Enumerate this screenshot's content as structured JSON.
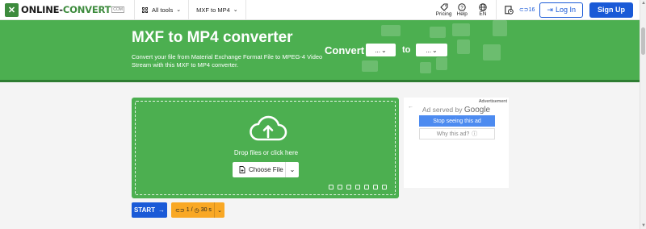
{
  "header": {
    "logo_text_a": "ONLINE-",
    "logo_text_b": "CONVERT",
    "logo_sub": "COM",
    "all_tools": "All tools",
    "converter_nav": "MXF to MP4",
    "pricing": "Pricing",
    "help": "Help",
    "language": "EN",
    "credits": "16",
    "login": "Log In",
    "signup": "Sign Up"
  },
  "banner": {
    "title": "MXF to MP4 converter",
    "description": "Convert your file from Material Exchange Format File to MPEG-4 Video Stream with this MXF to MP4 converter.",
    "convert_label": "Convert",
    "from_select": "...",
    "to_label": "to",
    "to_select": "..."
  },
  "upload": {
    "drop_text": "Drop files or click here",
    "choose_file": "Choose File"
  },
  "actions": {
    "start": "START",
    "limit_a": "1",
    "limit_sep": "/",
    "limit_b": "30 s"
  },
  "ad": {
    "label": "Advertisement",
    "served_by": "Ad served by",
    "google": "Google",
    "stop": "Stop seeing this ad",
    "why": "Why this ad?"
  }
}
